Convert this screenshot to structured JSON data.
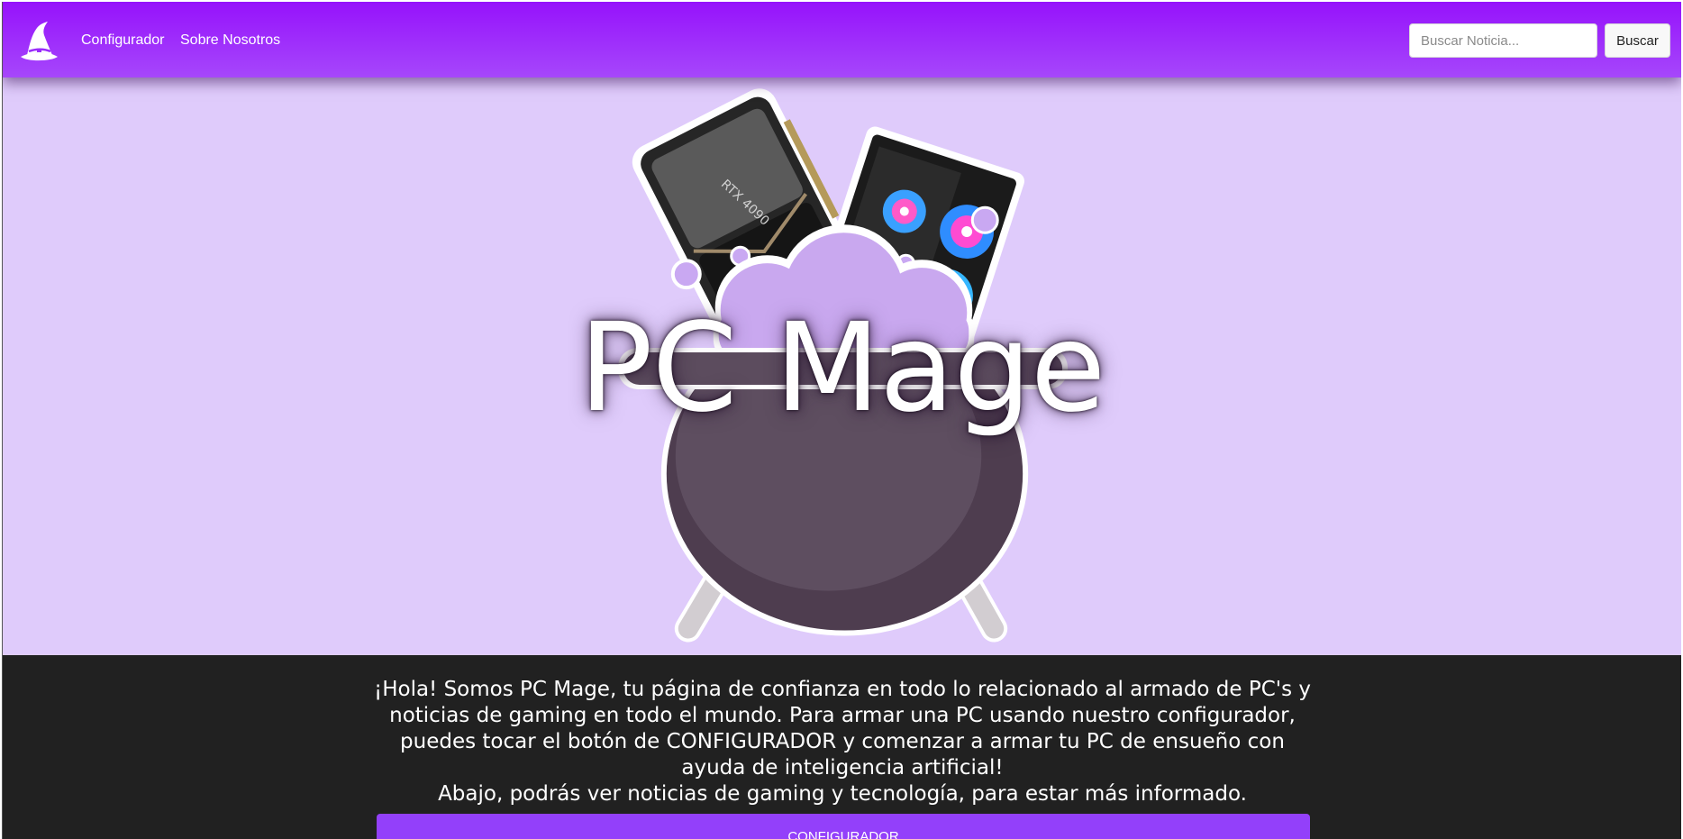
{
  "nav": {
    "logo_icon": "wizard-hat-icon",
    "links": [
      "Configurador",
      "Sobre Nosotros"
    ],
    "search_placeholder": "Buscar Noticia...",
    "search_button": "Buscar"
  },
  "hero": {
    "title": "PC Mage",
    "gpu_label": "RTX 4090"
  },
  "info": {
    "paragraph1": "¡Hola! Somos PC Mage, tu página de confianza en todo lo relacionado al armado de PC's y noticias de gaming en todo el mundo. Para armar una PC usando nuestro configurador, puedes tocar el botón de CONFIGURADOR y comenzar a armar tu PC de ensueño con ayuda de inteligencia artificial!",
    "paragraph2": "Abajo, podrás ver noticias de gaming y tecnología, para estar más informado.",
    "button": "CONFIGURADOR"
  },
  "colors": {
    "nav_top": "#9612fb",
    "nav_bottom": "#a647fb",
    "hero_bg": "#dfcbfb",
    "info_bg": "#212121",
    "button_bg": "#9340fa"
  }
}
